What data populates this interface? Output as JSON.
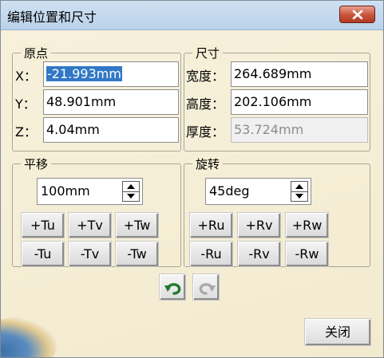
{
  "window": {
    "title": "编辑位置和尺寸"
  },
  "origin": {
    "legend": "原点",
    "rows": [
      {
        "label": "X：",
        "value": "-21.993mm"
      },
      {
        "label": "Y：",
        "value": "48.901mm"
      },
      {
        "label": "Z：",
        "value": "4.04mm"
      }
    ]
  },
  "dimensions": {
    "legend": "尺寸",
    "rows": [
      {
        "label": "宽度：",
        "value": "264.689mm",
        "enabled": true
      },
      {
        "label": "高度：",
        "value": "202.106mm",
        "enabled": true
      },
      {
        "label": "厚度：",
        "value": "53.724mm",
        "enabled": false
      }
    ]
  },
  "translate": {
    "legend": "平移",
    "step": "100mm",
    "buttons": [
      "+Tu",
      "+Tv",
      "+Tw",
      "-Tu",
      "-Tv",
      "-Tw"
    ]
  },
  "rotate": {
    "legend": "旋转",
    "step": "45deg",
    "buttons": [
      "+Ru",
      "+Rv",
      "+Rw",
      "-Ru",
      "-Rv",
      "-Rw"
    ]
  },
  "history": {
    "undo_icon": "undo-icon",
    "redo_icon": "redo-icon",
    "redo_enabled": false
  },
  "footer": {
    "close_label": "关闭"
  },
  "colors": {
    "title_bar": "#c4d9ee",
    "close_button": "#c9533b",
    "panel": "#f5efd8",
    "selection": "#3178c6"
  }
}
